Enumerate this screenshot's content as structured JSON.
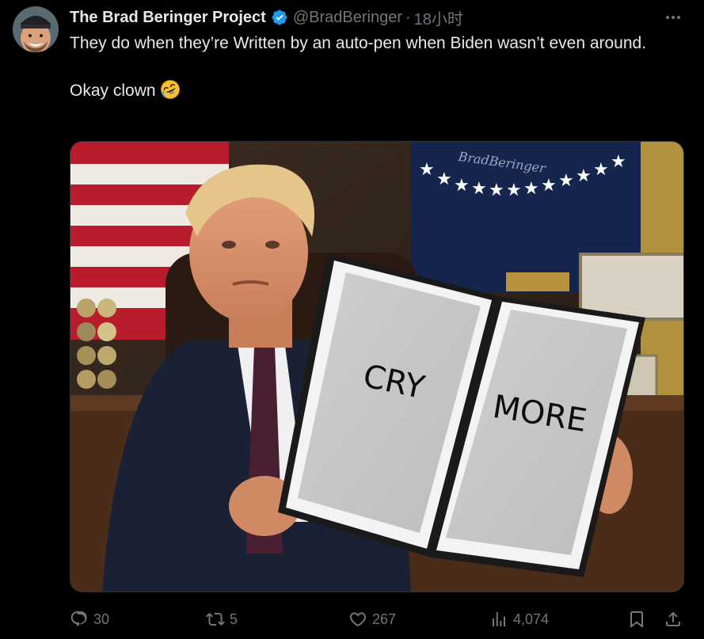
{
  "author": {
    "display_name": "The Brad Beringer Project",
    "handle": "@BradBeringer",
    "separator": "·",
    "time": "18小时",
    "verified": true
  },
  "tweet": {
    "line1": "They do when they’re Written by an auto-pen when Biden wasn’t even around.",
    "line2": "Okay clown",
    "emoji": "rolling-on-floor-laughing"
  },
  "media": {
    "left_page_text": "CRY",
    "right_page_text": "MORE",
    "watermark": "BradBeringer"
  },
  "actions": {
    "replies": "30",
    "reposts": "5",
    "likes": "267",
    "views": "4,074"
  },
  "colors": {
    "background": "#000000",
    "text": "#e7e9ea",
    "muted": "#71767b",
    "verified": "#1d9bf0"
  }
}
